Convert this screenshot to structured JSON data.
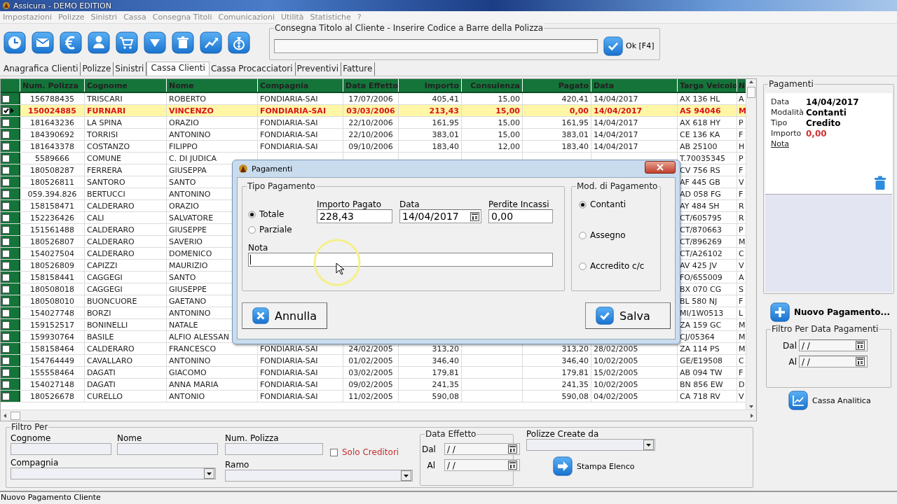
{
  "window": {
    "title": "Assicura - DEMO EDITION"
  },
  "menu": [
    "Impostazioni",
    "Polizze",
    "Sinistri",
    "Cassa",
    "Consegna Titoli",
    "Comunicazioni",
    "Utilità",
    "Statistiche",
    "?"
  ],
  "barcode_group": {
    "label": "Consegna Titolo al Cliente - Inserire Codice a Barre della Polizza",
    "ok_button": "Ok [F4]"
  },
  "tabs": [
    {
      "label": "Anagrafica Clienti",
      "selected": false
    },
    {
      "label": "Polizze",
      "selected": false
    },
    {
      "label": "Sinistri",
      "selected": false
    },
    {
      "label": "Cassa Clienti",
      "selected": true
    },
    {
      "label": "Cassa Procacciatori",
      "selected": false
    },
    {
      "label": "Preventivi",
      "selected": false
    },
    {
      "label": "Fatture",
      "selected": false
    }
  ],
  "table": {
    "columns": [
      "Num. Polizza",
      "Cognome",
      "Nome",
      "Compagnia",
      "Data Effetto",
      "Importo",
      "Consulenza",
      "Pagato",
      "Data",
      "Targa Veicolo",
      "N"
    ],
    "rows": [
      {
        "checked": false,
        "selected": false,
        "cells": [
          "156788435",
          "TRISCARI",
          "ROBERTO",
          "FONDIARIA-SAI",
          "17/07/2006",
          "405,41",
          "15,00",
          "420,41",
          "14/04/2017",
          "AX 136 HL",
          "A"
        ]
      },
      {
        "checked": true,
        "selected": true,
        "cells": [
          "150024885",
          "FURNARI",
          "VINCENZO",
          "FONDIARIA-SAI",
          "03/03/2006",
          "213,43",
          "15,00",
          "0,00",
          "14/04/2017",
          "AS 94046",
          "M"
        ]
      },
      {
        "checked": false,
        "selected": false,
        "cells": [
          "181643236",
          "LA SPINA",
          "ORAZIO",
          "FONDIARIA-SAI",
          "22/10/2006",
          "161,95",
          "15,00",
          "161,95",
          "14/04/2017",
          "AX 618 HY",
          "P"
        ]
      },
      {
        "checked": false,
        "selected": false,
        "cells": [
          "184390692",
          "TORRISI",
          "ANTONINO",
          "FONDIARIA-SAI",
          "22/10/2006",
          "383,01",
          "15,00",
          "383,01",
          "14/04/2017",
          "CE 136 KA",
          "F"
        ]
      },
      {
        "checked": false,
        "selected": false,
        "cells": [
          "181643378",
          "COSTANZO",
          "FILIPPO",
          "FONDIARIA-SAI",
          "09/10/2006",
          "183,40",
          "12,00",
          "183,40",
          "14/04/2017",
          "AB 25100",
          "H"
        ]
      },
      {
        "checked": false,
        "selected": false,
        "cells": [
          "5589666",
          "COMUNE",
          "C. DI JUDICA",
          null,
          null,
          null,
          null,
          null,
          null,
          "T.70035345",
          "P"
        ]
      },
      {
        "checked": false,
        "selected": false,
        "cells": [
          "180508287",
          "FERRERA",
          "GIUSEPPA",
          null,
          null,
          null,
          null,
          null,
          null,
          "CV 756 RS",
          "F"
        ]
      },
      {
        "checked": false,
        "selected": false,
        "cells": [
          "180526811",
          "SANTORO",
          "SANTO",
          null,
          null,
          null,
          null,
          null,
          null,
          "AF 445 GB",
          "V"
        ]
      },
      {
        "checked": false,
        "selected": false,
        "cells": [
          "059.394.826",
          "BERTUCCI",
          "ANTONINO",
          null,
          null,
          null,
          null,
          null,
          null,
          "AD 058 FG",
          "F"
        ]
      },
      {
        "checked": false,
        "selected": false,
        "cells": [
          "158158471",
          "CALDERARO",
          "ORAZIO",
          null,
          null,
          null,
          null,
          null,
          null,
          "AY 484 SH",
          "R"
        ]
      },
      {
        "checked": false,
        "selected": false,
        "cells": [
          "152236426",
          "CALI",
          "SALVATORE",
          null,
          null,
          null,
          null,
          null,
          null,
          "CT/605795",
          "R"
        ]
      },
      {
        "checked": false,
        "selected": false,
        "cells": [
          "151561488",
          "CALDERARO",
          "GIUSEPPE",
          null,
          null,
          null,
          null,
          null,
          null,
          "CT/870663",
          "P"
        ]
      },
      {
        "checked": false,
        "selected": false,
        "cells": [
          "180526807",
          "CALDERARO",
          "SAVERIO",
          null,
          null,
          null,
          null,
          null,
          null,
          "CT/896269",
          "M"
        ]
      },
      {
        "checked": false,
        "selected": false,
        "cells": [
          "154027504",
          "CALDERARO",
          "DOMENICO",
          null,
          null,
          null,
          null,
          null,
          null,
          "CT/A26102",
          "C"
        ]
      },
      {
        "checked": false,
        "selected": false,
        "cells": [
          "180526809",
          "CAPIZZI",
          "MAURIZIO",
          null,
          null,
          null,
          null,
          null,
          null,
          "AV 425 JV",
          "V"
        ]
      },
      {
        "checked": false,
        "selected": false,
        "cells": [
          "158158441",
          "CAGGEGI",
          "SANTO",
          null,
          null,
          null,
          null,
          null,
          null,
          "FO/655009",
          "A"
        ]
      },
      {
        "checked": false,
        "selected": false,
        "cells": [
          "180508018",
          "CAGGEGI",
          "GIUSEPPE",
          null,
          null,
          null,
          null,
          null,
          null,
          "BX 070 CG",
          "S"
        ]
      },
      {
        "checked": false,
        "selected": false,
        "cells": [
          "180508010",
          "BUONCUORE",
          "GAETANO",
          null,
          null,
          null,
          null,
          null,
          null,
          "BL 580 NJ",
          "F"
        ]
      },
      {
        "checked": false,
        "selected": false,
        "cells": [
          "154027748",
          "BORZI",
          "ANTONINO",
          null,
          null,
          null,
          null,
          null,
          null,
          "MI/1W0513",
          "L"
        ]
      },
      {
        "checked": false,
        "selected": false,
        "cells": [
          "159152517",
          "BONINELLI",
          "NATALE",
          null,
          null,
          null,
          null,
          null,
          null,
          "ZA 159 GC",
          "M"
        ]
      },
      {
        "checked": false,
        "selected": false,
        "cells": [
          "159930764",
          "BASILE",
          "ALFIO ALESSAN",
          null,
          null,
          null,
          null,
          null,
          null,
          "CJ/05364",
          "M"
        ]
      },
      {
        "checked": false,
        "selected": false,
        "cells": [
          "158158464",
          "CALDERARO",
          "FRANCESCO",
          "FONDIARIA-SAI",
          "24/02/2005",
          "313,20",
          null,
          "313,20",
          "28/02/2005",
          "ZA 114 PS",
          "M"
        ]
      },
      {
        "checked": false,
        "selected": false,
        "cells": [
          "154764449",
          "CAVALLARO",
          "ANTONINO",
          "FONDIARIA-SAI",
          "01/02/2005",
          "346,40",
          null,
          "346,40",
          "10/02/2005",
          "GE/E19508",
          "C"
        ]
      },
      {
        "checked": false,
        "selected": false,
        "cells": [
          "155558464",
          "DAGATI",
          "GIACOMO",
          "FONDIARIA-SAI",
          "03/02/2005",
          "179,81",
          null,
          "179,81",
          "15/02/2005",
          "AB 094 TW",
          "F"
        ]
      },
      {
        "checked": false,
        "selected": false,
        "cells": [
          "154027148",
          "DAGATI",
          "ANNA MARIA",
          "FONDIARIA-SAI",
          "09/02/2005",
          "241,35",
          null,
          "241,35",
          "10/02/2005",
          "BN 856 EW",
          "D"
        ]
      },
      {
        "checked": false,
        "selected": false,
        "cells": [
          "180526678",
          "CURELLO",
          "ANTONIO",
          "FONDIARIA-SAI",
          "11/02/2005",
          "590,08",
          null,
          "590,08",
          "04/02/2005",
          "CA 718 RV",
          "V"
        ]
      }
    ]
  },
  "payments_panel": {
    "title": "Pagamenti",
    "details": [
      {
        "label": "Data",
        "value": "14/04/2017"
      },
      {
        "label": "Modalità",
        "value": "Contanti"
      },
      {
        "label": "Tipo",
        "value": "Credito"
      },
      {
        "label": "Importo",
        "value": "0,00"
      }
    ],
    "note_link": "Nota",
    "new_button": "Nuovo Pagamento...",
    "date_filter": {
      "title": "Filtro Per Data Pagamenti",
      "from_label": "Dal",
      "from_value": "/ /",
      "to_label": "Al",
      "to_value": "/ /"
    },
    "analytics_button": "Cassa Analitica"
  },
  "filter": {
    "title": "Filtro Per",
    "cognome_label": "Cognome",
    "nome_label": "Nome",
    "polizza_label": "Num. Polizza",
    "only_creditors": {
      "label": "Solo Creditori",
      "checked": false
    },
    "compagnia_label": "Compagnia",
    "ramo_label": "Ramo",
    "date_group": {
      "title": "Data Effetto",
      "from_label": "Dal",
      "from_value": "/ /",
      "to_label": "Al",
      "to_value": "/ /"
    },
    "created_by_label": "Polizze Create da",
    "print_button": "Stampa Elenco"
  },
  "status_bar": "Nuovo Pagamento Cliente",
  "dialog": {
    "title": "Pagamenti",
    "type_group": "Tipo Pagamento",
    "type_options": [
      {
        "label": "Totale",
        "selected": true
      },
      {
        "label": "Parziale",
        "selected": false
      }
    ],
    "amount_label": "Importo Pagato",
    "amount_value": "228,43",
    "date_label": "Data",
    "date_value": "14/04/2017",
    "loss_label": "Perdite Incassi",
    "loss_value": "0,00",
    "note_label": "Nota",
    "mode_group": "Mod. di Pagamento",
    "mode_options": [
      {
        "label": "Contanti",
        "selected": true
      },
      {
        "label": "Assegno",
        "selected": false
      },
      {
        "label": "Accredito c/c",
        "selected": false
      }
    ],
    "cancel_button": "Annulla",
    "save_button": "Salva"
  }
}
